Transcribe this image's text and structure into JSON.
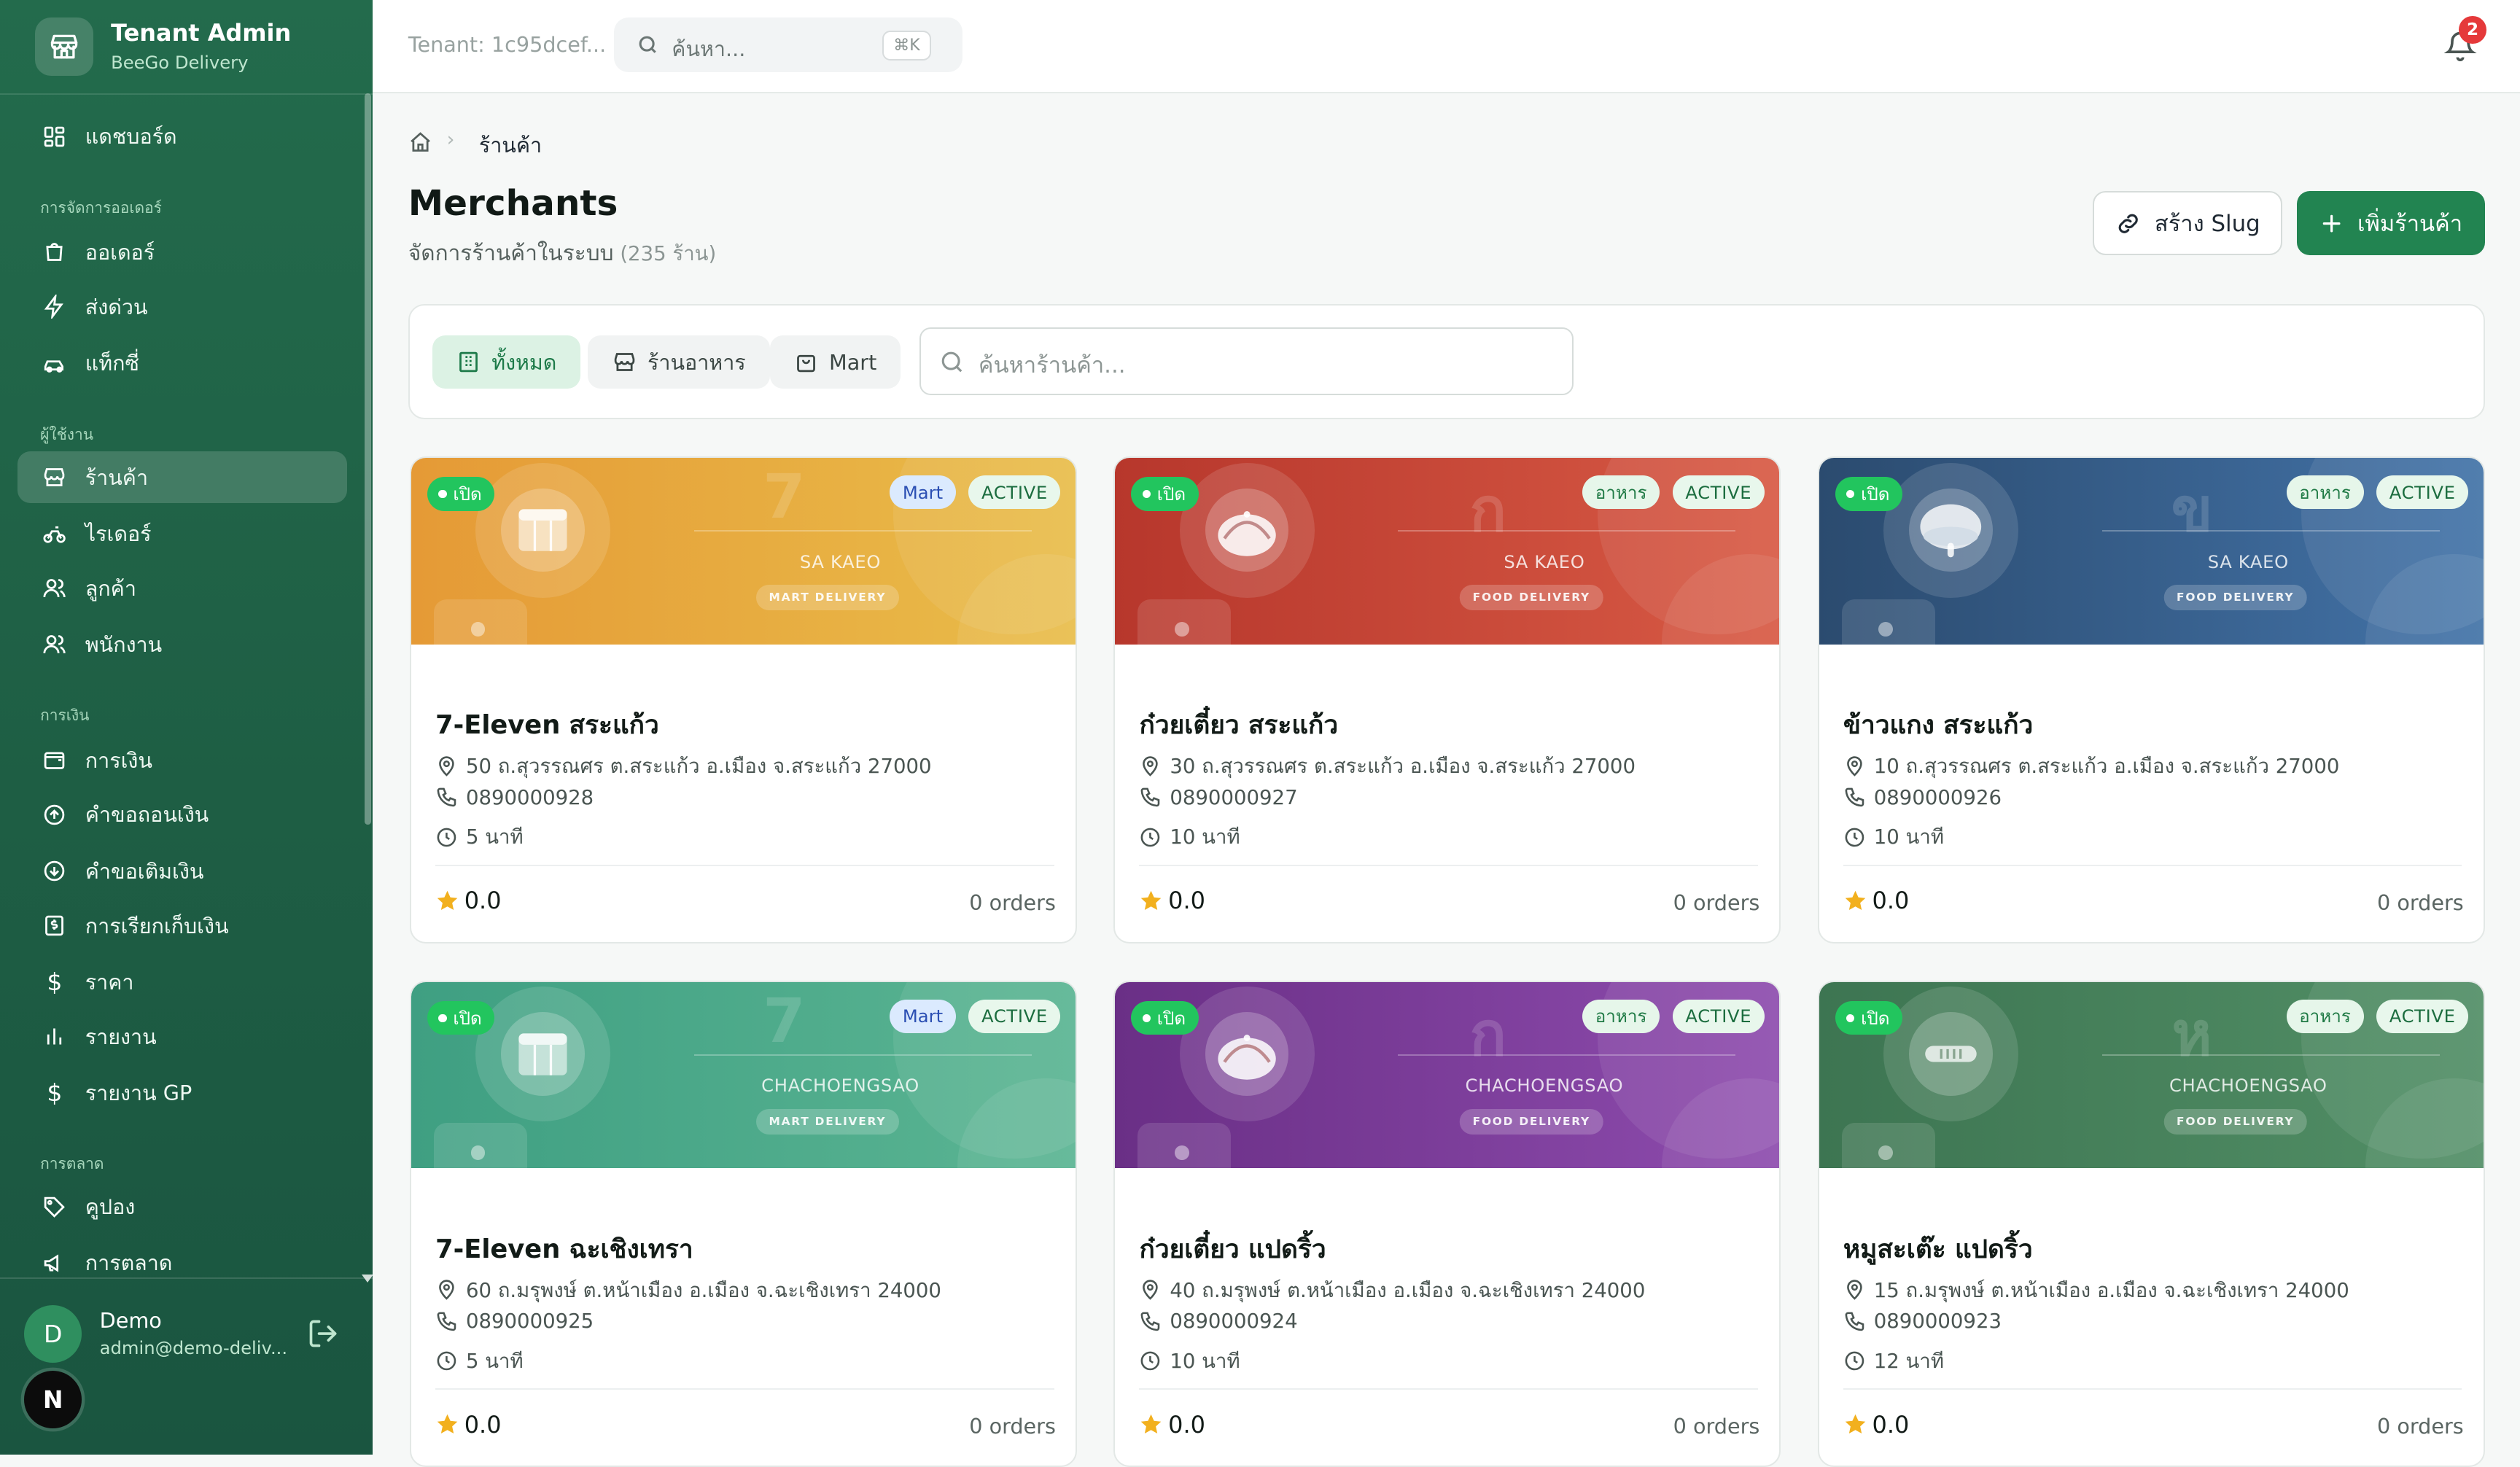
{
  "app": {
    "title": "Tenant Admin",
    "subtitle": "BeeGo Delivery"
  },
  "sidebar": {
    "dashboard": "แดชบอร์ด",
    "sections": {
      "orders": "การจัดการออเดอร์",
      "users": "ผู้ใช้งาน",
      "finance": "การเงิน",
      "marketing": "การตลาด"
    },
    "items": [
      {
        "label": "ออเดอร์",
        "icon": "shopping-bag-icon"
      },
      {
        "label": "ส่งด่วน",
        "icon": "zap-icon"
      },
      {
        "label": "แท็กซี่",
        "icon": "car-icon"
      },
      {
        "label": "ร้านค้า",
        "icon": "store-icon",
        "active": true
      },
      {
        "label": "ไรเดอร์",
        "icon": "bike-icon"
      },
      {
        "label": "ลูกค้า",
        "icon": "users-icon"
      },
      {
        "label": "พนักงาน",
        "icon": "users-icon"
      },
      {
        "label": "การเงิน",
        "icon": "wallet-icon"
      },
      {
        "label": "คำขอถอนเงิน",
        "icon": "arrow-up-circle-icon"
      },
      {
        "label": "คำขอเติมเงิน",
        "icon": "arrow-down-circle-icon"
      },
      {
        "label": "การเรียกเก็บเงิน",
        "icon": "receipt-icon"
      },
      {
        "label": "ราคา",
        "icon": "dollar-icon"
      },
      {
        "label": "รายงาน",
        "icon": "bar-chart-icon"
      },
      {
        "label": "รายงาน GP",
        "icon": "dollar-icon"
      },
      {
        "label": "คูปอง",
        "icon": "tag-icon"
      },
      {
        "label": "การตลาด",
        "icon": "megaphone-icon"
      }
    ],
    "user": {
      "initial": "D",
      "name": "Demo",
      "email": "admin@demo-deliv...",
      "badge": "N"
    }
  },
  "header": {
    "tenant": "Tenant: 1c95dcef...",
    "search_placeholder": "ค้นหา...",
    "shortcut": "⌘K",
    "notification_count": "2"
  },
  "breadcrumb": {
    "current": "ร้านค้า"
  },
  "page": {
    "title": "Merchants",
    "subtitle": "จัดการร้านค้าในระบบ",
    "count": "(235 ร้าน)",
    "slug_button": "สร้าง Slug",
    "add_button": "เพิ่มร้านค้า"
  },
  "filters": {
    "all": "ทั้งหมด",
    "restaurant": "ร้านอาหาร",
    "mart": "Mart",
    "search_placeholder": "ค้นหาร้านค้า..."
  },
  "colors": {
    "primary": "#228451",
    "sidebar": "#1e5e44",
    "open_badge": "#22c55e"
  },
  "merchants": [
    {
      "name": "7-Eleven สระแก้ว",
      "address": "50 ถ.สุวรรณศร ต.สระแก้ว อ.เมือง จ.สระแก้ว 27000",
      "phone": "0890000928",
      "time": "5 นาที",
      "rating": "0.0",
      "orders": "0 orders",
      "open": "เปิด",
      "type": "Mart",
      "status": "ACTIVE",
      "city": "SA KAEO",
      "delivery": "MART DELIVERY",
      "glyph": "7",
      "color_from": "#e59a36",
      "color_to": "#e9bd4a",
      "icon": "store-front-icon"
    },
    {
      "name": "ก๋วยเตี๋ยว สระแก้ว",
      "address": "30 ถ.สุวรรณศร ต.สระแก้ว อ.เมือง จ.สระแก้ว 27000",
      "phone": "0890000927",
      "time": "10 นาที",
      "rating": "0.0",
      "orders": "0 orders",
      "open": "เปิด",
      "type": "อาหาร",
      "status": "ACTIVE",
      "city": "SA KAEO",
      "delivery": "FOOD DELIVERY",
      "glyph": "ก",
      "color_from": "#b7372c",
      "color_to": "#d85a45",
      "icon": "cloche-icon"
    },
    {
      "name": "ข้าวแกง สระแก้ว",
      "address": "10 ถ.สุวรรณศร ต.สระแก้ว อ.เมือง จ.สระแก้ว 27000",
      "phone": "0890000926",
      "time": "10 นาที",
      "rating": "0.0",
      "orders": "0 orders",
      "open": "เปิด",
      "type": "อาหาร",
      "status": "ACTIVE",
      "city": "SA KAEO",
      "delivery": "FOOD DELIVERY",
      "glyph": "ข",
      "color_from": "#2b4b6f",
      "color_to": "#4373a8",
      "icon": "bowl-icon"
    },
    {
      "name": "7-Eleven ฉะเชิงเทรา",
      "address": "60 ถ.มรุพงษ์ ต.หน้าเมือง อ.เมือง จ.ฉะเชิงเทรา 24000",
      "phone": "0890000925",
      "time": "5 นาที",
      "rating": "0.0",
      "orders": "0 orders",
      "open": "เปิด",
      "type": "Mart",
      "status": "ACTIVE",
      "city": "CHACHOENGSAO",
      "delivery": "MART DELIVERY",
      "glyph": "7",
      "color_from": "#3f9f82",
      "color_to": "#5bb593",
      "icon": "store-front-icon"
    },
    {
      "name": "ก๋วยเตี๋ยว แปดริ้ว",
      "address": "40 ถ.มรุพงษ์ ต.หน้าเมือง อ.เมือง จ.ฉะเชิงเทรา 24000",
      "phone": "0890000924",
      "time": "10 นาที",
      "rating": "0.0",
      "orders": "0 orders",
      "open": "เปิด",
      "type": "อาหาร",
      "status": "ACTIVE",
      "city": "CHACHOENGSAO",
      "delivery": "FOOD DELIVERY",
      "glyph": "ก",
      "color_from": "#6a2f86",
      "color_to": "#8e4cae",
      "icon": "cloche-icon"
    },
    {
      "name": "หมูสะเต๊ะ แปดริ้ว",
      "address": "15 ถ.มรุพงษ์ ต.หน้าเมือง อ.เมือง จ.ฉะเชิงเทรา 24000",
      "phone": "0890000923",
      "time": "12 นาที",
      "rating": "0.0",
      "orders": "0 orders",
      "open": "เปิด",
      "type": "อาหาร",
      "status": "ACTIVE",
      "city": "CHACHOENGSAO",
      "delivery": "FOOD DELIVERY",
      "glyph": "ห",
      "color_from": "#3d7552",
      "color_to": "#528f66",
      "icon": "skewer-icon"
    }
  ]
}
